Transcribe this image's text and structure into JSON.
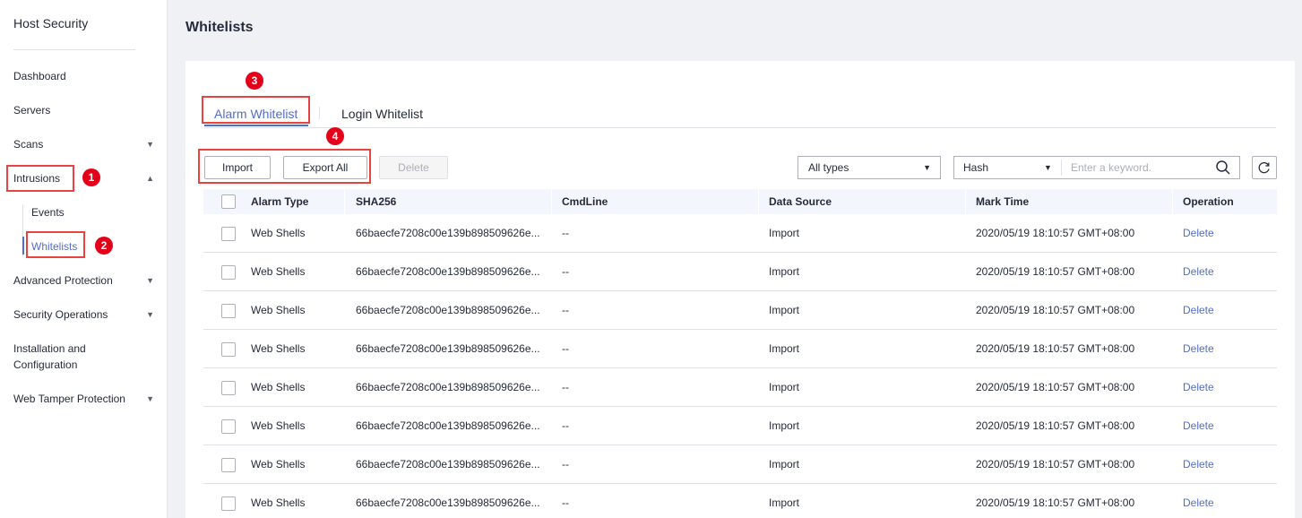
{
  "sidebar": {
    "title": "Host Security",
    "items": [
      {
        "label": "Dashboard"
      },
      {
        "label": "Servers"
      },
      {
        "label": "Scans"
      },
      {
        "label": "Intrusions"
      },
      {
        "label": "Advanced Protection"
      },
      {
        "label": "Security Operations"
      },
      {
        "label": "Installation and\nConfiguration"
      },
      {
        "label": "Web Tamper Protection"
      }
    ],
    "sub_items": [
      {
        "label": "Events"
      },
      {
        "label": "Whitelists"
      }
    ]
  },
  "annotations": [
    "1",
    "2",
    "3",
    "4"
  ],
  "page": {
    "title": "Whitelists"
  },
  "tabs": [
    {
      "label": "Alarm Whitelist",
      "active": true
    },
    {
      "label": "Login Whitelist",
      "active": false
    }
  ],
  "toolbar": {
    "import_label": "Import",
    "export_label": "Export All",
    "delete_label": "Delete",
    "type_filter": "All types",
    "search_field": "Hash",
    "search_placeholder": "Enter a keyword."
  },
  "table": {
    "columns": [
      "Alarm Type",
      "SHA256",
      "CmdLine",
      "Data Source",
      "Mark Time",
      "Operation"
    ],
    "rows": [
      {
        "type": "Web Shells",
        "sha256": "66baecfe7208c00e139b898509626e...",
        "cmdline": "--",
        "source": "Import",
        "time": "2020/05/19 18:10:57 GMT+08:00",
        "op": "Delete"
      },
      {
        "type": "Web Shells",
        "sha256": "66baecfe7208c00e139b898509626e...",
        "cmdline": "--",
        "source": "Import",
        "time": "2020/05/19 18:10:57 GMT+08:00",
        "op": "Delete"
      },
      {
        "type": "Web Shells",
        "sha256": "66baecfe7208c00e139b898509626e...",
        "cmdline": "--",
        "source": "Import",
        "time": "2020/05/19 18:10:57 GMT+08:00",
        "op": "Delete"
      },
      {
        "type": "Web Shells",
        "sha256": "66baecfe7208c00e139b898509626e...",
        "cmdline": "--",
        "source": "Import",
        "time": "2020/05/19 18:10:57 GMT+08:00",
        "op": "Delete"
      },
      {
        "type": "Web Shells",
        "sha256": "66baecfe7208c00e139b898509626e...",
        "cmdline": "--",
        "source": "Import",
        "time": "2020/05/19 18:10:57 GMT+08:00",
        "op": "Delete"
      },
      {
        "type": "Web Shells",
        "sha256": "66baecfe7208c00e139b898509626e...",
        "cmdline": "--",
        "source": "Import",
        "time": "2020/05/19 18:10:57 GMT+08:00",
        "op": "Delete"
      },
      {
        "type": "Web Shells",
        "sha256": "66baecfe7208c00e139b898509626e...",
        "cmdline": "--",
        "source": "Import",
        "time": "2020/05/19 18:10:57 GMT+08:00",
        "op": "Delete"
      },
      {
        "type": "Web Shells",
        "sha256": "66baecfe7208c00e139b898509626e...",
        "cmdline": "--",
        "source": "Import",
        "time": "2020/05/19 18:10:57 GMT+08:00",
        "op": "Delete"
      }
    ]
  },
  "colors": {
    "accent": "#526ecc",
    "annotation": "#e50019"
  }
}
